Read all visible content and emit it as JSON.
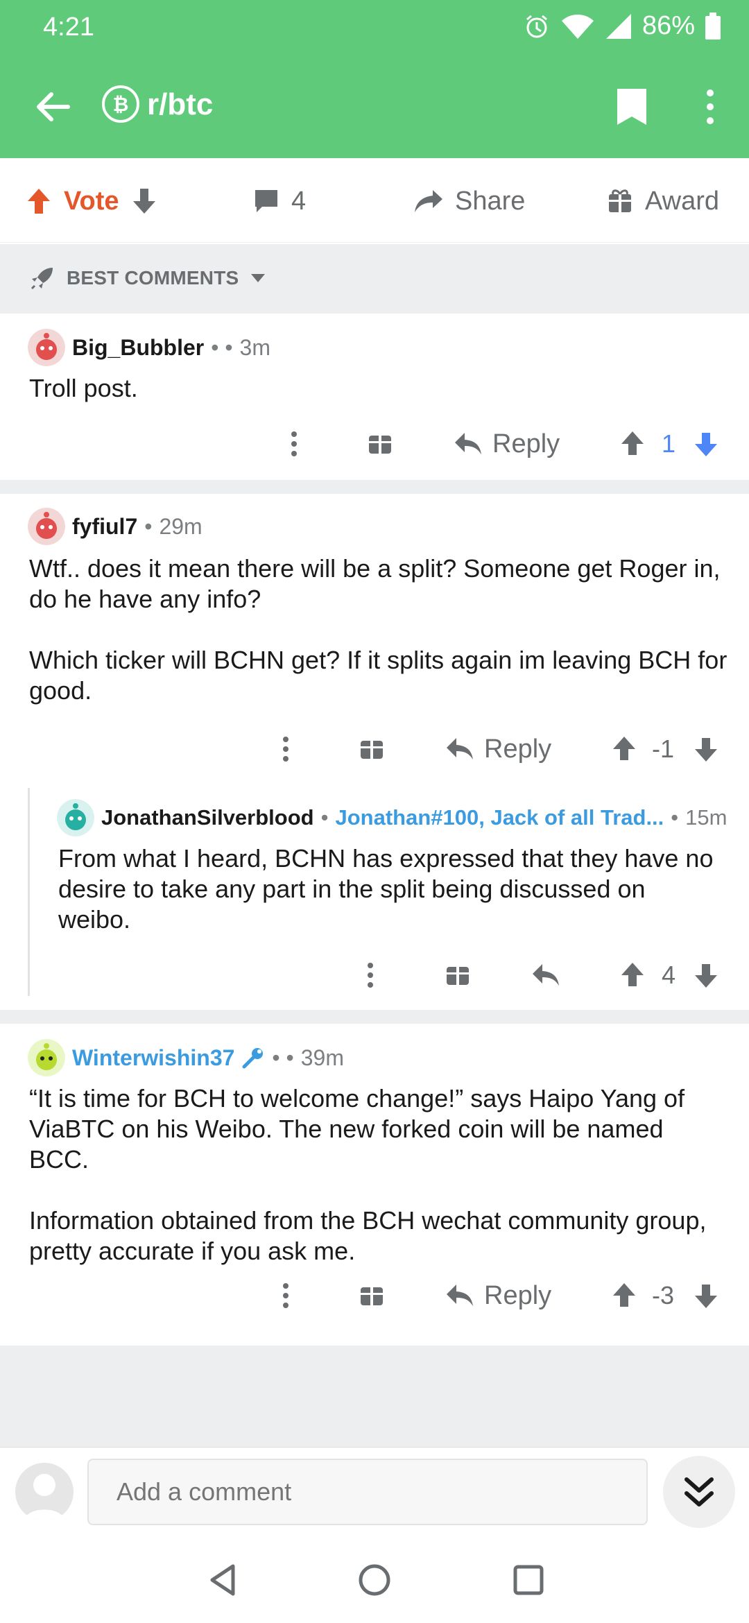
{
  "status": {
    "time": "4:21",
    "battery": "86%"
  },
  "header": {
    "subreddit": "r/btc"
  },
  "actions": {
    "vote_label": "Vote",
    "comment_count": "4",
    "share_label": "Share",
    "award_label": "Award"
  },
  "sort": {
    "label": "BEST COMMENTS"
  },
  "comments": [
    {
      "author": "Big_Bubbler",
      "flair": "",
      "time": "3m",
      "body": [
        "Troll post."
      ],
      "reply_label": "Reply",
      "score": "1"
    },
    {
      "author": "fyfiul7",
      "flair": "",
      "time": "29m",
      "body": [
        "Wtf.. does it mean there will be a split? Someone get Roger in, do he have any info?",
        "Which ticker will BCHN get? If it splits again im leaving BCH for good."
      ],
      "reply_label": "Reply",
      "score": "-1"
    },
    {
      "author": "JonathanSilverblood",
      "flair": "Jonathan#100, Jack of all Trad...",
      "time": "15m",
      "body": [
        "From what I heard, BCHN has expressed that they have no desire to take any part in the split being discussed on weibo."
      ],
      "reply_label": "",
      "score": "4"
    },
    {
      "author": "Winterwishin37",
      "flair": "",
      "time": "39m",
      "body": [
        "“It is time for BCH to welcome change!” says Haipo Yang of ViaBTC on his Weibo. The new forked coin will be named BCC.",
        "Information obtained from the BCH wechat community group, pretty accurate if you ask me."
      ],
      "reply_label": "Reply",
      "score": "-3"
    }
  ],
  "composer": {
    "placeholder": "Add a comment"
  },
  "colors": {
    "brand_green": "#5fca79",
    "vote_orange": "#e4572a",
    "downvote_blue": "#4f86f7",
    "flair_blue": "#3b9be0"
  }
}
